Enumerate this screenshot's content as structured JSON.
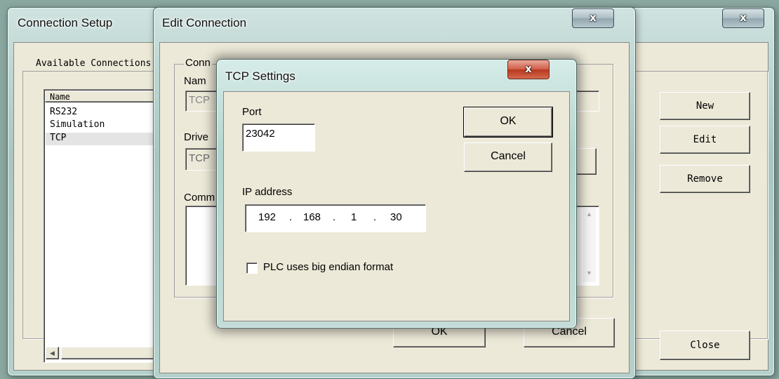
{
  "connection_setup": {
    "title": "Connection Setup",
    "close_glyph": "x",
    "available_label": "Available Connections",
    "list_header": "Name",
    "items": [
      "RS232",
      "Simulation",
      "TCP"
    ],
    "selected_index": 2,
    "scroll_left_glyph": "◀",
    "buttons": {
      "new": "New",
      "edit": "Edit",
      "remove": "Remove",
      "close": "Close"
    }
  },
  "edit_connection": {
    "title": "Edit Connection",
    "close_glyph": "x",
    "group_label": "Conn",
    "name_label": "Nam",
    "name_value": "TCP",
    "driver_label": "Drive",
    "driver_value": "TCP",
    "comment_label": "Comm",
    "ok_label": "OK",
    "cancel_label": "Cancel",
    "scroll_up_glyph": "▲",
    "scroll_down_glyph": "▼"
  },
  "tcp_settings": {
    "title": "TCP Settings",
    "close_glyph": "x",
    "port_label": "Port",
    "port_value": "23042",
    "ok_label": "OK",
    "cancel_label": "Cancel",
    "ip_label": "IP address",
    "ip_octets": [
      "192",
      "168",
      "1",
      "30"
    ],
    "ip_separator": ".",
    "checkbox_label": "PLC uses big endian format",
    "checkbox_checked": false
  }
}
